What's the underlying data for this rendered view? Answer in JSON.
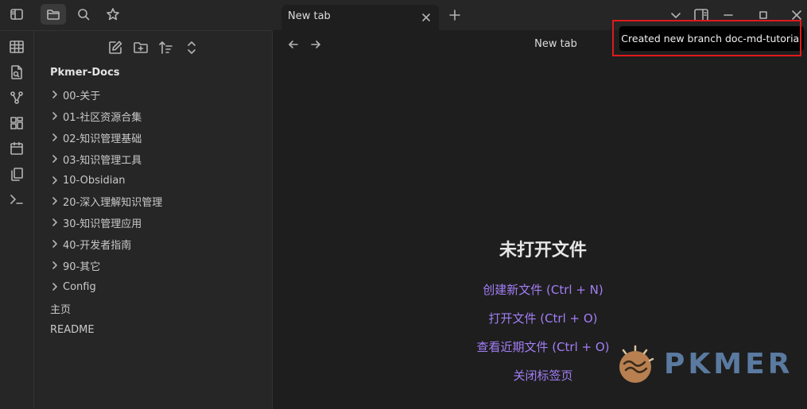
{
  "titlebar": {
    "tab_label": "New tab",
    "icons": [
      "sidebar-toggle-icon",
      "folder-icon",
      "search-icon",
      "star-icon"
    ],
    "window_icons": [
      "chevron-down-icon",
      "sidebar-right-icon",
      "minimize-icon",
      "maximize-icon",
      "close-icon"
    ]
  },
  "ribbon": {
    "icons": [
      "table-icon",
      "file-search-icon",
      "graph-icon",
      "dashboard-icon",
      "calendar-icon",
      "copy-icon",
      "terminal-icon"
    ]
  },
  "sidebar": {
    "toolbar_icons": [
      "new-note-icon",
      "new-folder-icon",
      "sort-icon",
      "collapse-icon"
    ],
    "vault_name": "Pkmer-Docs",
    "folders": [
      {
        "label": "00-关于"
      },
      {
        "label": "01-社区资源合集"
      },
      {
        "label": "02-知识管理基础"
      },
      {
        "label": "03-知识管理工具"
      },
      {
        "label": "10-Obsidian"
      },
      {
        "label": "20-深入理解知识管理"
      },
      {
        "label": "30-知识管理应用"
      },
      {
        "label": "40-开发者指南"
      },
      {
        "label": "90-其它"
      },
      {
        "label": "Config"
      }
    ],
    "files": [
      {
        "label": "主页"
      },
      {
        "label": "README"
      }
    ]
  },
  "main": {
    "view_title": "New tab",
    "empty_title": "未打开文件",
    "actions": [
      {
        "label": "创建新文件 (Ctrl + N)"
      },
      {
        "label": "打开文件 (Ctrl + O)"
      },
      {
        "label": "查看近期文件 (Ctrl + O)"
      },
      {
        "label": "关闭标签页"
      }
    ]
  },
  "notice": {
    "text": "Created new branch doc-md-tutorial"
  },
  "watermark": {
    "text": "PKMER"
  },
  "colors": {
    "accent": "#a27ef5",
    "highlight": "#e0191b",
    "background": "#1e1e1e",
    "panel": "#262626"
  }
}
